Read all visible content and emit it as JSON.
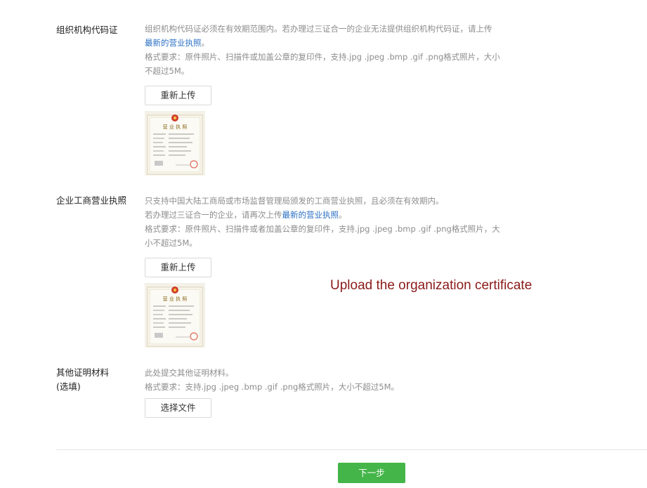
{
  "org_code": {
    "label": "组织机构代码证",
    "desc_line1": "组织机构代码证必须在有效期范围内。若办理过三证合一的企业无法提供组织机构代码证，请上传",
    "desc_link": "最新的营业执照",
    "desc_after_link": "。",
    "format_line1": "格式要求：原件照片、扫描件或加盖公章的复印件，支持.jpg .jpeg .bmp .gif .png格式照片，大小",
    "format_line2": "不超过5M。",
    "button_label": "重新上传",
    "image_title": "营 业 执 照"
  },
  "business_license": {
    "label": "企业工商营业执照",
    "desc_line1": "只支持中国大陆工商局或市场监督管理局颁发的工商营业执照，且必须在有效期内。",
    "desc_line2_before": "若办理过三证合一的企业，请再次上传",
    "desc_link": "最新的营业执照",
    "desc_after_link": "。",
    "format_line1": "格式要求：原件照片、扫描件或者加盖公章的复印件，支持.jpg .jpeg .bmp .gif .png格式照片，大",
    "format_line2": "小不超过5M。",
    "button_label": "重新上传",
    "image_title": "营 业 执 照"
  },
  "other_materials": {
    "label_line1": "其他证明材料",
    "label_line2": "(选填)",
    "desc_line1": "此处提交其他证明材料。",
    "format_line1": "格式要求：支持.jpg .jpeg .bmp .gif .png格式照片，大小不超过5M。",
    "button_label": "选择文件"
  },
  "caption": "Upload the organization certificate",
  "next_button": "下一步",
  "colors": {
    "link": "#2b6fc4",
    "primary_button": "#44b549",
    "caption": "#8b1a1a"
  }
}
